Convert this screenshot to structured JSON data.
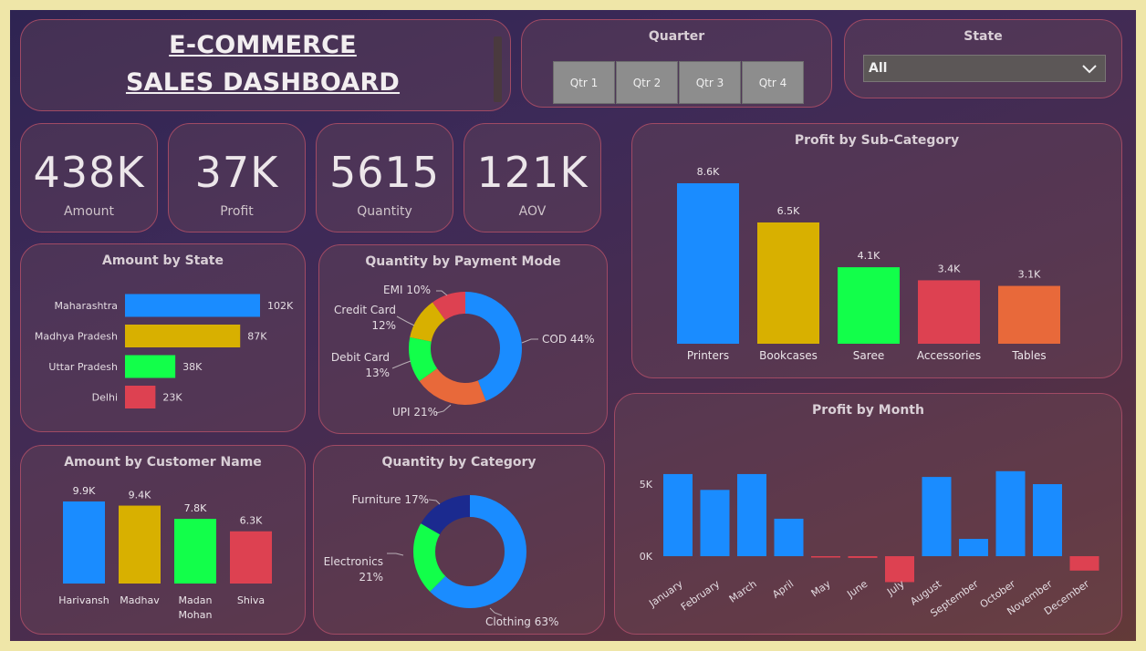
{
  "header": {
    "title_line1": "E-COMMERCE ",
    "title_line2": "SALES DASHBOARD"
  },
  "quarter_slicer": {
    "label": "Quarter",
    "options": [
      "Qtr 1",
      "Qtr 2",
      "Qtr 3",
      "Qtr 4"
    ]
  },
  "state_slicer": {
    "label": "State",
    "selected": "All"
  },
  "kpis": [
    {
      "value": "438K",
      "label": "Amount"
    },
    {
      "value": "37K",
      "label": "Profit"
    },
    {
      "value": "5615",
      "label": "Quantity"
    },
    {
      "value": "121K",
      "label": "AOV"
    }
  ],
  "colors": {
    "blue": "#1a8cff",
    "yellow": "#d8b000",
    "green": "#12ff4a",
    "red": "#dd4151",
    "orange": "#e8693a",
    "navy": "#1b2a8f"
  },
  "chart_data": [
    {
      "type": "bar",
      "orientation": "horizontal",
      "title": "Amount by State",
      "categories": [
        "Maharashtra",
        "Madhya Pradesh",
        "Uttar Pradesh",
        "Delhi"
      ],
      "values": [
        102000,
        87000,
        38000,
        23000
      ],
      "labels": [
        "102K",
        "87K",
        "38K",
        "23K"
      ]
    },
    {
      "type": "pie",
      "variant": "donut",
      "title": "Quantity by Payment Mode",
      "categories": [
        "COD",
        "UPI",
        "Debit Card",
        "Credit Card",
        "EMI"
      ],
      "values": [
        44,
        21,
        13,
        12,
        10
      ],
      "label_lines": [
        [
          "COD 44%"
        ],
        [
          "UPI 21%"
        ],
        [
          "Debit Card",
          "13%"
        ],
        [
          "Credit Card",
          "12%"
        ],
        [
          "EMI 10%"
        ]
      ]
    },
    {
      "type": "bar",
      "title": "Profit by Sub-Category",
      "categories": [
        "Printers",
        "Bookcases",
        "Saree",
        "Accessories",
        "Tables"
      ],
      "values": [
        8600,
        6500,
        4100,
        3400,
        3100
      ],
      "labels": [
        "8.6K",
        "6.5K",
        "4.1K",
        "3.4K",
        "3.1K"
      ]
    },
    {
      "type": "bar",
      "title": "Amount by Customer Name",
      "categories": [
        "Harivansh",
        "Madhav",
        "Madan Mohan",
        "Shiva"
      ],
      "category_lines": [
        [
          "Harivansh"
        ],
        [
          "Madhav"
        ],
        [
          "Madan",
          "Mohan"
        ],
        [
          "Shiva"
        ]
      ],
      "values": [
        9900,
        9400,
        7800,
        6300
      ],
      "labels": [
        "9.9K",
        "9.4K",
        "7.8K",
        "6.3K"
      ]
    },
    {
      "type": "pie",
      "variant": "donut",
      "title": "Quantity by Category",
      "categories": [
        "Clothing",
        "Electronics",
        "Furniture"
      ],
      "values": [
        63,
        21,
        17
      ],
      "label_lines": [
        [
          "Clothing 63%"
        ],
        [
          "Electronics",
          "21%"
        ],
        [
          "Furniture 17%"
        ]
      ]
    },
    {
      "type": "bar",
      "title": "Profit by Month",
      "categories": [
        "January",
        "February",
        "March",
        "April",
        "May",
        "June",
        "July",
        "August",
        "September",
        "October",
        "November",
        "December"
      ],
      "values": [
        5700,
        4600,
        5700,
        2600,
        -60,
        -120,
        -1800,
        5500,
        1200,
        5900,
        5000,
        -1000
      ],
      "y_ticks": [
        {
          "value": 5000,
          "label": "5K"
        },
        {
          "value": 0,
          "label": "0K"
        }
      ],
      "ylim": [
        -2000,
        6500
      ]
    }
  ]
}
